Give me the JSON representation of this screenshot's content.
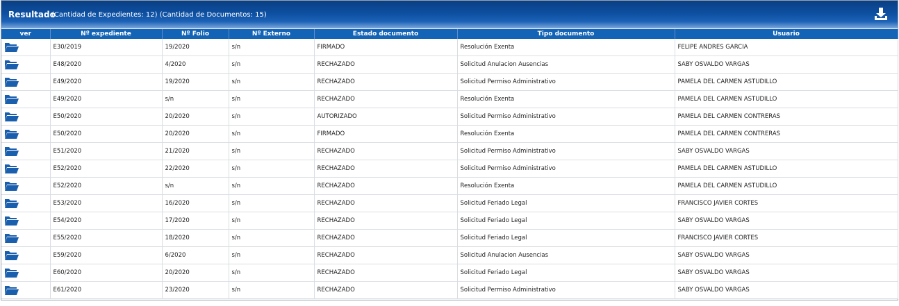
{
  "header": {
    "title": "Resultado",
    "subtitle": "(Cantidad de Expedientes: 12) (Cantidad de Documentos: 15)",
    "download_icon": "download-icon"
  },
  "table": {
    "columns": [
      "ver",
      "Nº expediente",
      "Nº Folio",
      "Nº Externo",
      "Estado documento",
      "Tipo documento",
      "Usuario"
    ],
    "rows": [
      [
        "E30/2019",
        "19/2020",
        "s/n",
        "FIRMADO",
        "Resolución Exenta",
        "FELIPE ANDRES GARCIA"
      ],
      [
        "E48/2020",
        "4/2020",
        "s/n",
        "RECHAZADO",
        "Solicitud Anulacion Ausencias",
        "SABY OSVALDO VARGAS"
      ],
      [
        "E49/2020",
        "19/2020",
        "s/n",
        "RECHAZADO",
        "Solicitud Permiso Administrativo",
        "PAMELA DEL CARMEN ASTUDILLO"
      ],
      [
        "E49/2020",
        "s/n",
        "s/n",
        "RECHAZADO",
        "Resolución Exenta",
        "PAMELA DEL CARMEN ASTUDILLO"
      ],
      [
        "E50/2020",
        "20/2020",
        "s/n",
        "AUTORIZADO",
        "Solicitud Permiso Administrativo",
        "PAMELA DEL CARMEN CONTRERAS"
      ],
      [
        "E50/2020",
        "20/2020",
        "s/n",
        "FIRMADO",
        "Resolución Exenta",
        "PAMELA DEL CARMEN CONTRERAS"
      ],
      [
        "E51/2020",
        "21/2020",
        "s/n",
        "RECHAZADO",
        "Solicitud Permiso Administrativo",
        "SABY OSVALDO VARGAS"
      ],
      [
        "E52/2020",
        "22/2020",
        "s/n",
        "RECHAZADO",
        "Solicitud Permiso Administrativo",
        "PAMELA DEL CARMEN ASTUDILLO"
      ],
      [
        "E52/2020",
        "s/n",
        "s/n",
        "RECHAZADO",
        "Resolución Exenta",
        "PAMELA DEL CARMEN ASTUDILLO"
      ],
      [
        "E53/2020",
        "16/2020",
        "s/n",
        "RECHAZADO",
        "Solicitud Feriado Legal",
        "FRANCISCO JAVIER CORTES"
      ],
      [
        "E54/2020",
        "17/2020",
        "s/n",
        "RECHAZADO",
        "Solicitud Feriado Legal",
        "SABY OSVALDO VARGAS"
      ],
      [
        "E55/2020",
        "18/2020",
        "s/n",
        "RECHAZADO",
        "Solicitud Feriado Legal",
        "FRANCISCO JAVIER CORTES"
      ],
      [
        "E59/2020",
        "6/2020",
        "s/n",
        "RECHAZADO",
        "Solicitud Anulacion Ausencias",
        "SABY OSVALDO VARGAS"
      ],
      [
        "E60/2020",
        "20/2020",
        "s/n",
        "RECHAZADO",
        "Solicitud Feriado Legal",
        "SABY OSVALDO VARGAS"
      ],
      [
        "E61/2020",
        "23/2020",
        "s/n",
        "RECHAZADO",
        "Solicitud Permiso Administrativo",
        "SABY OSVALDO VARGAS"
      ]
    ]
  },
  "colors": {
    "header_bg": "#0d4fa0",
    "column_header_bg": "#1364b6",
    "folder_icon": "#1a5fae"
  }
}
